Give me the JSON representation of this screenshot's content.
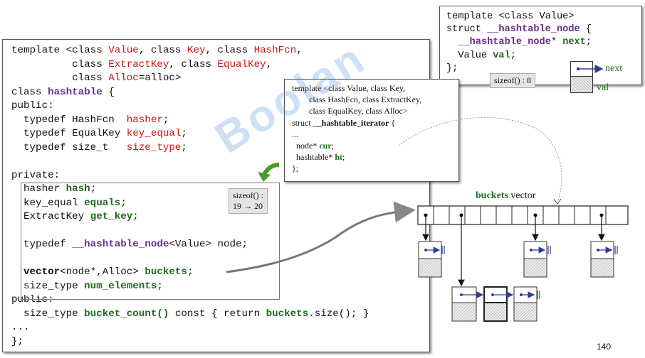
{
  "main_code": {
    "l1": [
      "template <class ",
      "Value",
      ", class ",
      "Key",
      ", class ",
      "HashFcn",
      ","
    ],
    "l2": [
      "          class ",
      "ExtractKey",
      ", class ",
      "EqualKey",
      ","
    ],
    "l3": [
      "          class ",
      "Alloc",
      "=alloc>"
    ],
    "l4": [
      "class ",
      "hashtable",
      " {"
    ],
    "l5": "public:",
    "l6": [
      "  typedef HashFcn  ",
      "hasher",
      ";"
    ],
    "l7": [
      "  typedef EqualKey ",
      "key_equal",
      ";"
    ],
    "l8": [
      "  typedef size_t   ",
      "size_type",
      ";"
    ],
    "l9": "private:",
    "l10": [
      "  hasher ",
      "hash",
      ";"
    ],
    "l11": [
      "  key_equal ",
      "equals",
      ";"
    ],
    "l12": [
      "  ExtractKey ",
      "get_key",
      ";"
    ],
    "l13": [
      "  typedef ",
      "__hashtable_node",
      "<Value> node;"
    ],
    "l14": [
      "  ",
      "vector",
      "<node*,Alloc> ",
      "buckets",
      ";"
    ],
    "l15": [
      "  size_type ",
      "num_elements",
      ";"
    ],
    "l16": "public:",
    "l17": [
      "  size_type ",
      "bucket_count()",
      " const { return ",
      "buckets",
      ".size(); }"
    ],
    "l18": "...",
    "l19": "};"
  },
  "sizeof_main": {
    "line1": "sizeof() :",
    "line2": "19 → 20"
  },
  "node_code": {
    "l1": "template <class Value>",
    "l2": [
      "struct ",
      "__hashtable_node",
      " {"
    ],
    "l3": [
      "  ",
      "__hashtable_node",
      "* ",
      "next",
      ";"
    ],
    "l4": [
      "  Value ",
      "val",
      ";"
    ],
    "l5": "};"
  },
  "sizeof_node": "sizeof() : 8",
  "node_labels": {
    "next": "next",
    "val": "val"
  },
  "iter_code": {
    "l1": "template <class Value, class Key,",
    "l2": "        class HashFcn, class ExtractKey,",
    "l3": "        class EqualKey, class Alloc>",
    "l4": [
      "struct ",
      "__hashtable_iterator",
      " {"
    ],
    "l5": "...",
    "l6": [
      "  node* ",
      "cur",
      ";"
    ],
    "l7": [
      "  hashtable* ",
      "ht",
      ";"
    ],
    "l8": "};"
  },
  "buckets_label": {
    "name": "buckets",
    "rest": " vector"
  },
  "page_number": "140",
  "watermark": "Boolan"
}
